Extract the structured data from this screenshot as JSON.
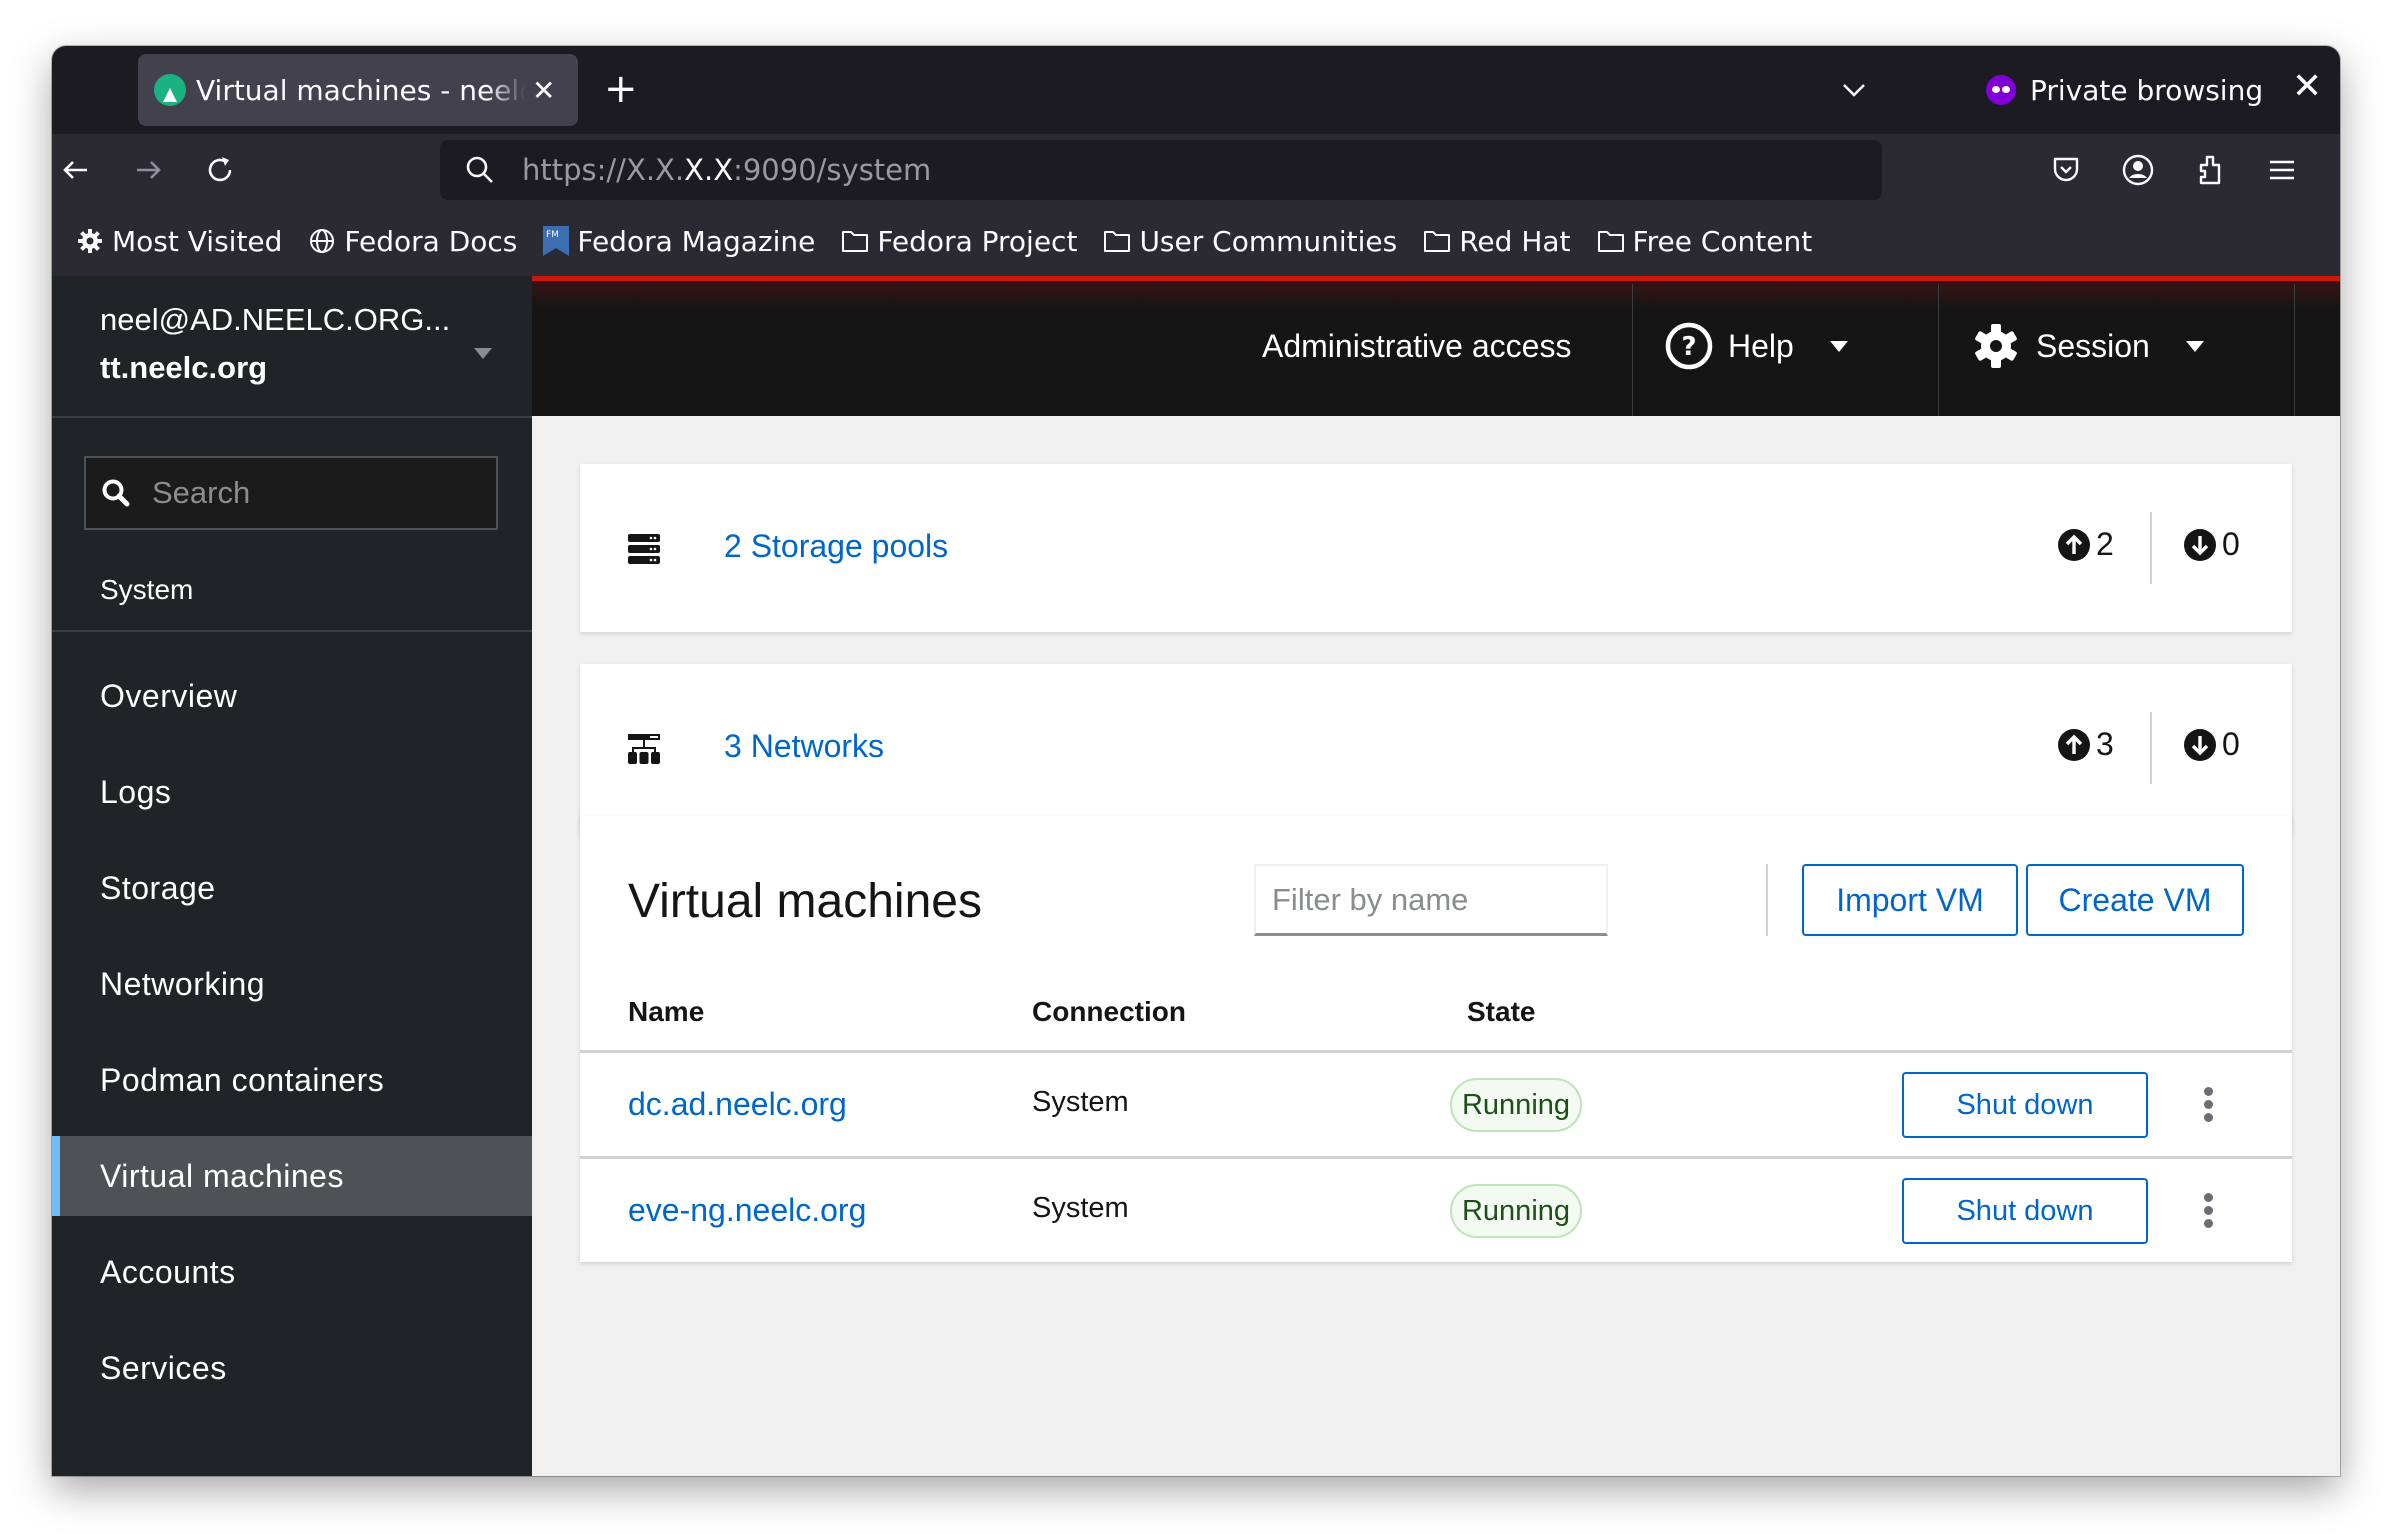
{
  "browser": {
    "tab": {
      "title": "Virtual machines - neel@AD.NEELC.ORG",
      "favicon": "cockpit-logo-icon"
    },
    "new_tab_label": "+",
    "private_label": "Private browsing",
    "url": {
      "prefix": "https://X.X.",
      "highlight": "X.X",
      "suffix": ":9090/system"
    },
    "bookmarks": [
      {
        "label": "Most Visited",
        "icon": "gear-icon"
      },
      {
        "label": "Fedora Docs",
        "icon": "globe-icon"
      },
      {
        "label": "Fedora Magazine",
        "icon": "fedora-magazine-icon"
      },
      {
        "label": "Fedora Project",
        "icon": "folder-icon"
      },
      {
        "label": "User Communities",
        "icon": "folder-icon"
      },
      {
        "label": "Red Hat",
        "icon": "folder-icon"
      },
      {
        "label": "Free Content",
        "icon": "folder-icon"
      }
    ]
  },
  "host": {
    "user": "neel@AD.NEELC.ORG...",
    "hostname": "tt.neelc.org"
  },
  "sidebar": {
    "search_placeholder": "Search",
    "section": "System",
    "items": [
      {
        "label": "Overview",
        "active": false
      },
      {
        "label": "Logs",
        "active": false
      },
      {
        "label": "Storage",
        "active": false
      },
      {
        "label": "Networking",
        "active": false
      },
      {
        "label": "Podman containers",
        "active": false
      },
      {
        "label": "Virtual machines",
        "active": true
      },
      {
        "label": "Accounts",
        "active": false
      },
      {
        "label": "Services",
        "active": false
      }
    ]
  },
  "topbar": {
    "admin_access": "Administrative access",
    "help": "Help",
    "session": "Session"
  },
  "summary": {
    "storage": {
      "label": "2 Storage pools",
      "active": "2",
      "inactive": "0"
    },
    "networks": {
      "label": "3 Networks",
      "active": "3",
      "inactive": "0"
    }
  },
  "vms": {
    "title": "Virtual machines",
    "filter_placeholder": "Filter by name",
    "import_label": "Import VM",
    "create_label": "Create VM",
    "columns": [
      "Name",
      "Connection",
      "State"
    ],
    "rows": [
      {
        "name": "dc.ad.neelc.org",
        "connection": "System",
        "state": "Running",
        "action": "Shut down"
      },
      {
        "name": "eve-ng.neelc.org",
        "connection": "System",
        "state": "Running",
        "action": "Shut down"
      }
    ]
  },
  "colors": {
    "accent": "#0066cc",
    "active_nav": "#73bcf7",
    "header_red": "#c9190b",
    "running_green": "#1e4f18"
  }
}
